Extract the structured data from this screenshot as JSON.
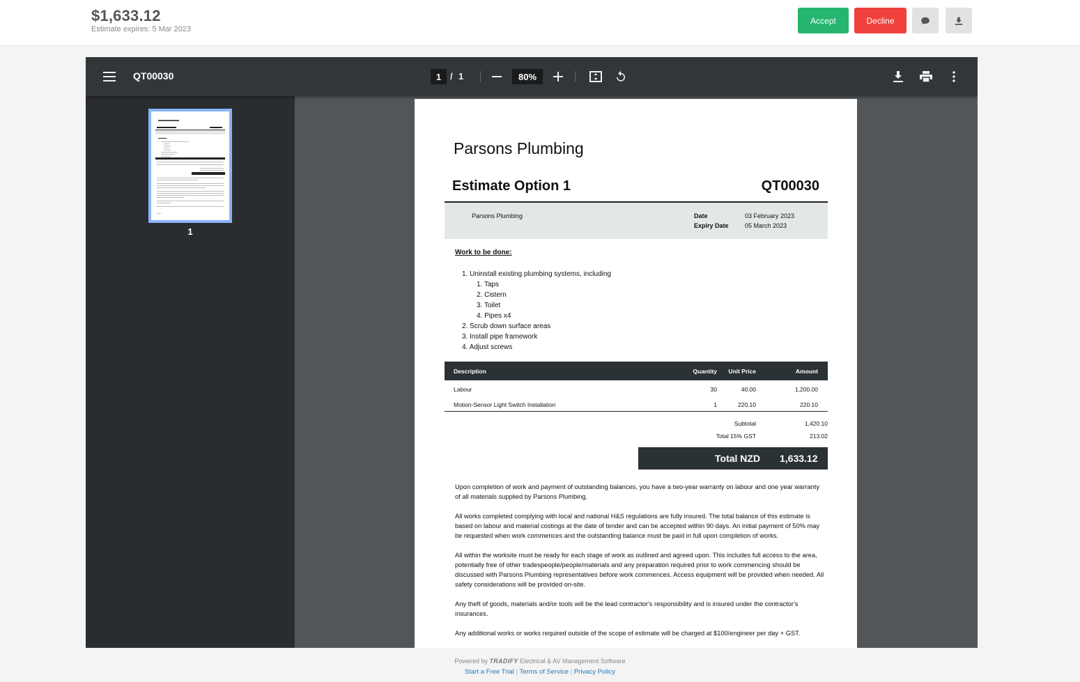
{
  "header": {
    "amount": "$1,633.12",
    "expires_label": "Estimate expires:",
    "expires_value": "5 Mar 2023",
    "accept_label": "Accept",
    "decline_label": "Decline",
    "comment_icon": "comment-icon",
    "download_icon": "download-icon",
    "accept_color": "#25b56f",
    "decline_color": "#f0413c"
  },
  "viewer": {
    "title": "QT00030",
    "current_page": "1",
    "page_separator": "/",
    "total_pages": "1",
    "zoom": "80%",
    "thumbnail_label": "1"
  },
  "document": {
    "company": "Parsons Plumbing",
    "title": "Estimate Option 1",
    "number": "QT00030",
    "from": "Parsons Plumbing",
    "date_label": "Date",
    "date_value": "03 February 2023",
    "expiry_label": "Expiry Date",
    "expiry_value": "05 March 2023",
    "work_heading": "Work to be done:",
    "work_items": [
      "1. Uninstall existing plumbing systems, including",
      "1. Taps",
      "2. Cistern",
      "3. Toilet",
      "4. Pipes x4",
      "2. Scrub down surface areas",
      "3. Install pipe framework",
      "4. Adjust screws"
    ],
    "table": {
      "headers": [
        "Description",
        "Quantity",
        "Unit Price",
        "Amount"
      ],
      "rows": [
        [
          "Labour",
          "30",
          "40.00",
          "1,200.00"
        ],
        [
          "Motion-Sensor Light Switch Installation",
          "1",
          "220.10",
          "220.10"
        ]
      ]
    },
    "subtotal_label": "Subtotal",
    "subtotal_value": "1,420.10",
    "gst_label": "Total 15% GST",
    "gst_value": "213.02",
    "total_label": "Total NZD",
    "total_value": "1,633.12",
    "terms": [
      "Upon completion of work and payment of outstanding balances, you have a two-year warranty on labour and one year warranty of all materials supplied by Parsons Plumbing.",
      "All works completed complying with local and national H&S regulations are fully insured. The total balance of this estimate is based on labour and material costings at the date of tender and can be accepted within 90 days.  An initial payment of 50% may be requested when work commences and the outstanding balance must be paid in full upon completion of works.",
      "All within the worksite must be ready for each stage of work as outlined and agreed upon. This includes full access to the area, potentially free of other tradespeople/people/materials and any preparation required prior to work commencing should be discussed with Parsons Plumbing representatives before work commences. Access equipment will be provided when needed. All safety considerations will be provided on-site.",
      "Any theft of goods, materials and/or tools will be the lead contractor's responsibility and is insured under the contractor's insurances.",
      "Any additional works or works required outside of the scope of estimate will be charged at $100/engineer per day + GST."
    ]
  },
  "footer": {
    "powered_by": "Powered by",
    "brand": "TRADIFY",
    "tagline": "Electrical & AV Management Software",
    "link_trial": "Start a Free Trial",
    "link_terms": "Terms of Service",
    "link_privacy": "Privacy Policy",
    "separator": "|"
  }
}
